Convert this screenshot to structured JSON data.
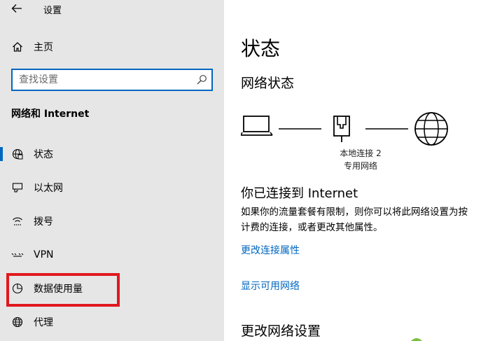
{
  "window": {
    "title": "设置",
    "back_icon": "arrow-left-icon"
  },
  "sidebar": {
    "home": {
      "label": "主页",
      "icon": "home-icon"
    },
    "search": {
      "placeholder": "查找设置",
      "icon": "search-icon"
    },
    "section_title": "网络和 Internet",
    "items": [
      {
        "label": "状态",
        "icon": "globe-status-icon",
        "active": true
      },
      {
        "label": "以太网",
        "icon": "ethernet-icon"
      },
      {
        "label": "拨号",
        "icon": "dialup-icon"
      },
      {
        "label": "VPN",
        "icon": "vpn-icon"
      },
      {
        "label": "数据使用量",
        "icon": "data-usage-icon",
        "highlighted": true
      },
      {
        "label": "代理",
        "icon": "globe-icon"
      }
    ],
    "accent_color": "#0067c0",
    "highlight_color": "#e0191e"
  },
  "main": {
    "title": "状态",
    "network_status_heading": "网络状态",
    "adapter_name": "本地连接 2",
    "network_type": "专用网络",
    "connected_heading": "你已连接到 Internet",
    "description_line1": "如果你的流量套餐有限制，则你可以将此网络设置为按",
    "description_line2": "计费的连接，或者更改其他属性。",
    "link_change_properties": "更改连接属性",
    "link_show_networks": "显示可用网络",
    "change_network_heading": "更改网络设置"
  }
}
